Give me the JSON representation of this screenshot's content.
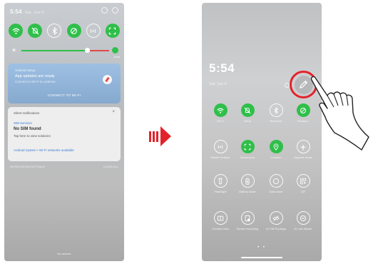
{
  "left_panel": {
    "status_time": "5:54",
    "status_date": "Sat, Jun 6",
    "brightness_auto_label": "Auto",
    "notification_app": {
      "app": "Android Setup",
      "title": "App updates are ready",
      "body": "Connect to Wi-Fi to continue",
      "action": "CONNECT TO WI-FI"
    },
    "notification_silent": {
      "header": "Silent notifications",
      "sim_source": "SIM services",
      "sim_title": "No SIM found",
      "sim_body": "Tap here to view solutions",
      "system_text": "Android System • Wi-Fi networks available"
    },
    "footer_left": "NOTIFICATION SETTINGS",
    "footer_right": "CLEAR ALL",
    "bottom_text": "No service"
  },
  "right_panel": {
    "time": "5:54",
    "date": "Sat, Jun 6",
    "tiles": [
      {
        "label": "Wi-Fi",
        "state": "on",
        "icon": "wifi-icon"
      },
      {
        "label": "Silent",
        "state": "on",
        "icon": "mute-icon"
      },
      {
        "label": "Bluetooth",
        "state": "off",
        "icon": "bluetooth-icon"
      },
      {
        "label": "Rotation",
        "state": "on",
        "icon": "rotate-icon"
      },
      {
        "label": "Mobile Hotspot",
        "state": "off",
        "icon": "hotspot-icon"
      },
      {
        "label": "Screenshot",
        "state": "on",
        "icon": "screenshot-icon"
      },
      {
        "label": "Location",
        "state": "on",
        "icon": "location-icon"
      },
      {
        "label": "Airplane mode",
        "state": "off",
        "icon": "airplane-icon"
      },
      {
        "label": "Flashlight",
        "state": "off",
        "icon": "flashlight-icon"
      },
      {
        "label": "Battery saver",
        "state": "off",
        "icon": "battery-icon"
      },
      {
        "label": "Data saver",
        "state": "off",
        "icon": "data-saver-icon"
      },
      {
        "label": "QR",
        "state": "off",
        "icon": "qr-icon"
      },
      {
        "label": "Comfort view",
        "state": "off",
        "icon": "comfort-view-icon"
      },
      {
        "label": "Screen recording",
        "state": "off",
        "icon": "screen-recording-icon"
      },
      {
        "label": "LE DB Routings",
        "state": "off",
        "icon": "eye-off-icon"
      },
      {
        "label": "Do not disturb",
        "state": "off",
        "icon": "dnd-icon"
      }
    ],
    "page_indicator": "• •"
  },
  "colors": {
    "accent_green": "#2fbf4a",
    "highlight_red": "#e3232b"
  }
}
